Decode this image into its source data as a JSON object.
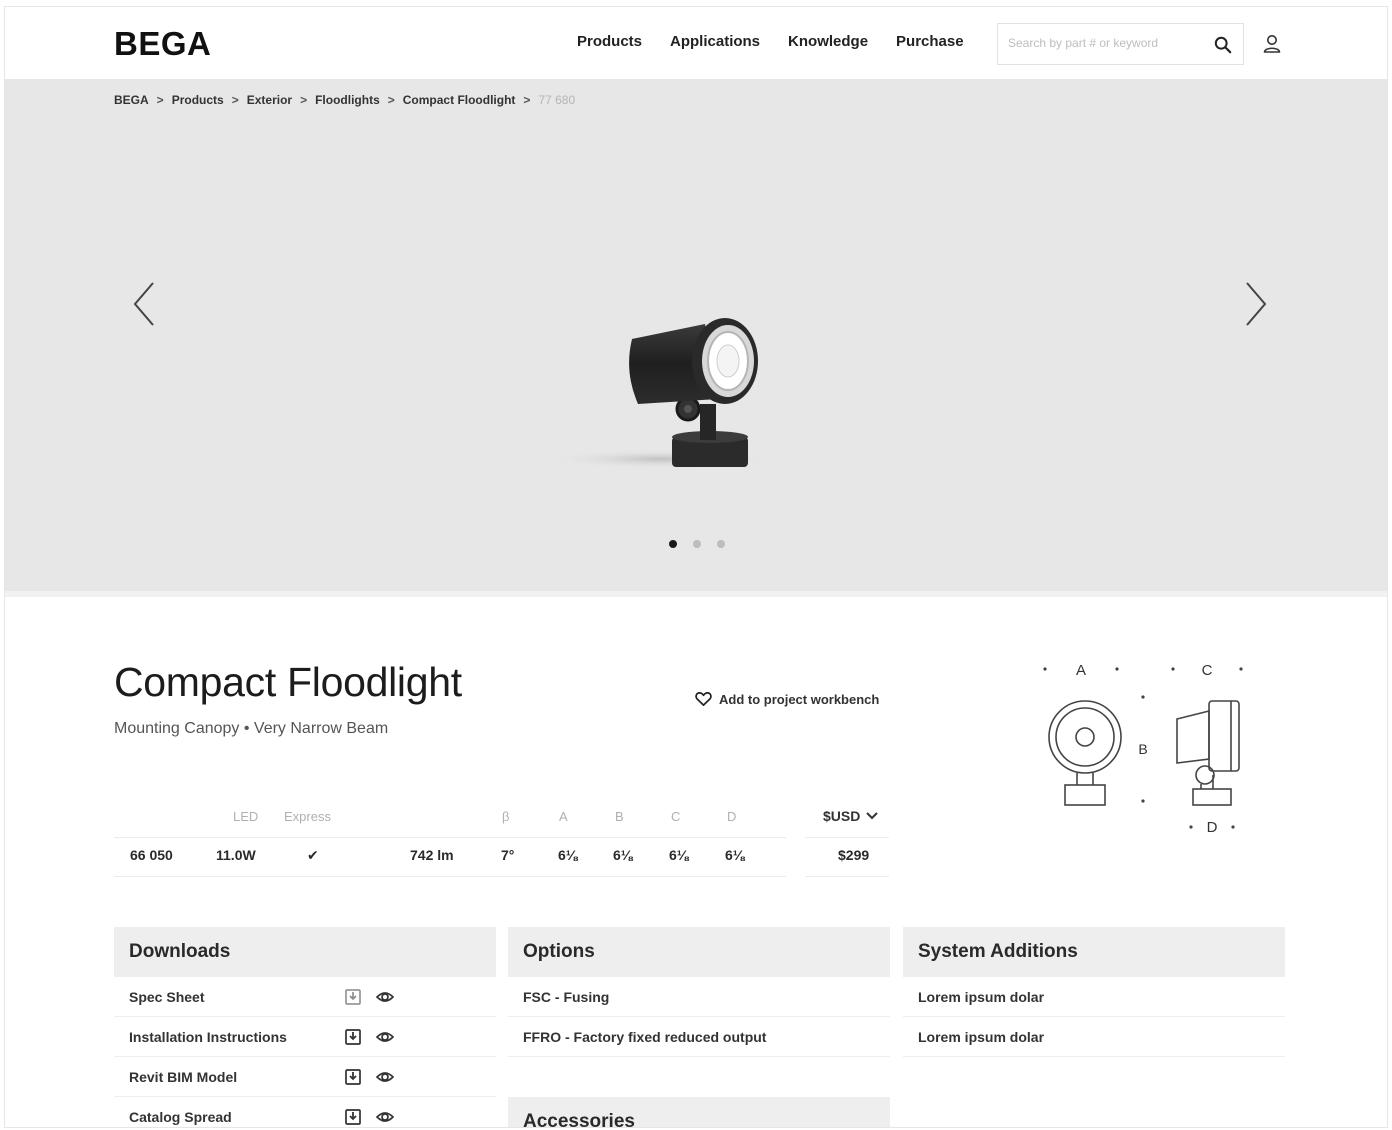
{
  "header": {
    "logo": "BEGA",
    "nav": [
      "Products",
      "Applications",
      "Knowledge",
      "Purchase"
    ],
    "search_placeholder": "Search by part # or keyword"
  },
  "breadcrumb": {
    "items": [
      "BEGA",
      "Products",
      "Exterior",
      "Floodlights",
      "Compact Floodlight"
    ],
    "current": "77 680",
    "separator": ">"
  },
  "carousel": {
    "slide_count": 3,
    "active_index": 0
  },
  "product": {
    "title": "Compact Floodlight",
    "subtitle": "Mounting Canopy • Very Narrow Beam",
    "workbench_label": "Add to project workbench"
  },
  "diagram_labels": {
    "a": "A",
    "b": "B",
    "c": "C",
    "d": "D"
  },
  "spec_table": {
    "headers": [
      "LED",
      "Express",
      "β",
      "A",
      "B",
      "C",
      "D"
    ],
    "currency": "$USD",
    "row": {
      "part": "66 050",
      "led": "11.0W",
      "express": "✔",
      "lumens": "742 lm",
      "beta": "7°",
      "a": "6⅛",
      "b": "6⅛",
      "c": "6⅛",
      "d": "6⅛",
      "price": "$299"
    }
  },
  "panels": {
    "downloads": {
      "title": "Downloads",
      "items": [
        "Spec Sheet",
        "Installation Instructions",
        "Revit BIM Model",
        "Catalog Spread"
      ]
    },
    "options": {
      "title": "Options",
      "items": [
        "FSC - Fusing",
        "FFRO - Factory fixed reduced output"
      ]
    },
    "system_additions": {
      "title": "System Additions",
      "items": [
        "Lorem ipsum dolar",
        "Lorem ipsum dolar"
      ]
    },
    "accessories": {
      "title": "Accessories"
    }
  }
}
